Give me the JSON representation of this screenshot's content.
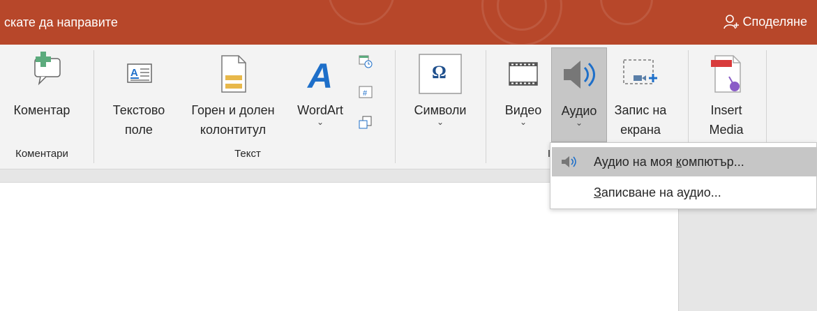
{
  "colors": {
    "titlebar": "#b7472a",
    "ribbon": "#f3f3f3",
    "highlight": "#c6c6c6",
    "accent_green": "#5cab7d",
    "accent_blue": "#1e6fc9"
  },
  "titlebar": {
    "tell_me": "скате да направите",
    "share": "Споделяне"
  },
  "comments_group": {
    "comment_button": "Коментар",
    "label": "Коментари"
  },
  "text_group": {
    "textbox_line1": "Текстово",
    "textbox_line2": "поле",
    "header_line1": "Горен и долен",
    "header_line2": "колонтитул",
    "wordart": "WordArt",
    "label": "Текст"
  },
  "symbols_group": {
    "symbols": "Символи"
  },
  "media_group": {
    "video": "Видео",
    "audio": "Аудио",
    "screen_rec_line1": "Запис на",
    "screen_rec_line2": "екрана",
    "label_partial": "I"
  },
  "insert_media": {
    "line1": "Insert",
    "line2": "Media"
  },
  "audio_menu": {
    "items": [
      {
        "label_pre": "Аудио на моя ",
        "label_u": "к",
        "label_post": "омпютър...",
        "icon": "speaker-icon",
        "highlighted": true
      },
      {
        "label_pre": "",
        "label_u": "З",
        "label_post": "аписване на аудио...",
        "icon": "",
        "highlighted": false
      }
    ]
  }
}
